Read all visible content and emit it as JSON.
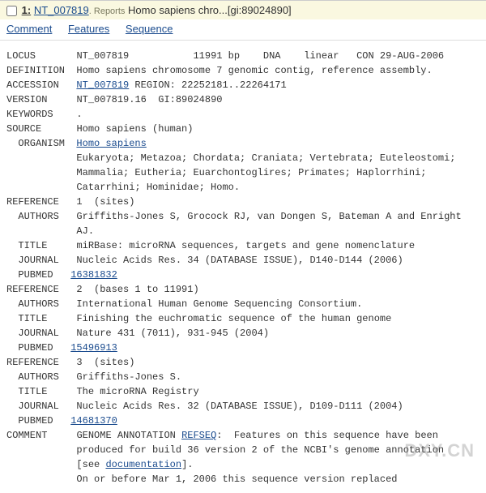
{
  "header": {
    "index": "1:",
    "accession_link": "NT_007819",
    "reports_label": ". Reports",
    "title": " Homo sapiens chro...[gi:89024890]"
  },
  "tabs": {
    "comment": "Comment",
    "features": "Features",
    "sequence": "Sequence"
  },
  "fields": {
    "locus_label": "LOCUS",
    "locus_value": "NT_007819           11991 bp    DNA    linear   CON 29-AUG-2006",
    "definition_label": "DEFINITION",
    "definition_value": "Homo sapiens chromosome 7 genomic contig, reference assembly.",
    "accession_label": "ACCESSION",
    "accession_link": "NT_007819",
    "accession_rest": " REGION: 22252181..22264171",
    "version_label": "VERSION",
    "version_value": "NT_007819.16  GI:89024890",
    "keywords_label": "KEYWORDS",
    "keywords_value": ".",
    "source_label": "SOURCE",
    "source_value": "Homo sapiens (human)",
    "organism_label": "  ORGANISM",
    "organism_link": "Homo sapiens",
    "lineage1": "Eukaryota; Metazoa; Chordata; Craniata; Vertebrata; Euteleostomi;",
    "lineage2": "Mammalia; Eutheria; Euarchontoglires; Primates; Haplorrhini;",
    "lineage3": "Catarrhini; Hominidae; Homo.",
    "ref1_label": "REFERENCE",
    "ref1_value": "1  (sites)",
    "ref1_authors_label": "  AUTHORS",
    "ref1_authors1": "Griffiths-Jones S, Grocock RJ, van Dongen S, Bateman A and Enright",
    "ref1_authors2": "AJ.",
    "ref1_title_label": "  TITLE",
    "ref1_title_value": "miRBase: microRNA sequences, targets and gene nomenclature",
    "ref1_journal_label": "  JOURNAL",
    "ref1_journal_value": "Nucleic Acids Res. 34 (DATABASE ISSUE), D140-D144 (2006)",
    "ref1_pubmed_label": "  PUBMED",
    "ref1_pubmed_link": "16381832",
    "ref2_label": "REFERENCE",
    "ref2_value": "2  (bases 1 to 11991)",
    "ref2_authors_label": "  AUTHORS",
    "ref2_authors_value": "International Human Genome Sequencing Consortium.",
    "ref2_title_label": "  TITLE",
    "ref2_title_value": "Finishing the euchromatic sequence of the human genome",
    "ref2_journal_label": "  JOURNAL",
    "ref2_journal_value": "Nature 431 (7011), 931-945 (2004)",
    "ref2_pubmed_label": "  PUBMED",
    "ref2_pubmed_link": "15496913",
    "ref3_label": "REFERENCE",
    "ref3_value": "3  (sites)",
    "ref3_authors_label": "  AUTHORS",
    "ref3_authors_value": "Griffiths-Jones S.",
    "ref3_title_label": "  TITLE",
    "ref3_title_value": "The microRNA Registry",
    "ref3_journal_label": "  JOURNAL",
    "ref3_journal_value": "Nucleic Acids Res. 32 (DATABASE ISSUE), D109-D111 (2004)",
    "ref3_pubmed_label": "  PUBMED",
    "ref3_pubmed_link": "14681370",
    "comment_label": "COMMENT",
    "comment_pre": "GENOME ANNOTATION ",
    "comment_refseq": "REFSEQ",
    "comment_post": ":  Features on this sequence have been",
    "comment_line2a": "produced for build 36 version 2 of the NCBI's genome annotation",
    "comment_line3a": "[see ",
    "comment_doc_link": "documentation",
    "comment_line3b": "].",
    "comment_line4": "On or before Mar 1, 2006 this sequence version replaced"
  },
  "watermark": "DXY.CN"
}
